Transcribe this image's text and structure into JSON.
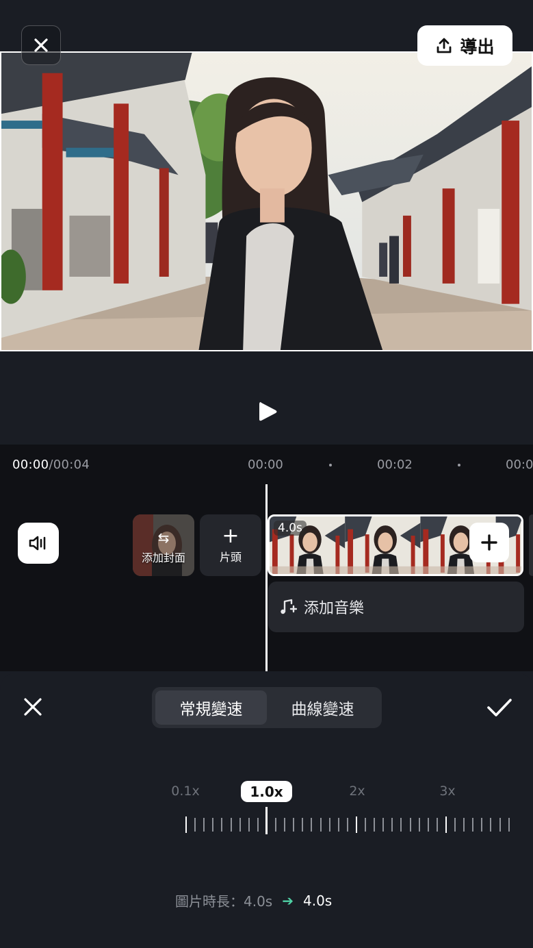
{
  "topbar": {
    "export_label": "導出"
  },
  "timeline": {
    "current_time": "00:00",
    "total_time": "/00:04",
    "ruler": [
      "00:00",
      "00:02",
      "00:0"
    ],
    "cover_label": "添加封面",
    "head_label": "片頭",
    "clip_duration": "4.0s",
    "music_label": "添加音樂"
  },
  "speed_panel": {
    "tabs": [
      {
        "label": "常規變速",
        "active": true
      },
      {
        "label": "曲線變速",
        "active": false
      }
    ],
    "speed_marks": [
      "0.1x",
      "2x",
      "3x"
    ],
    "selected_speed": "1.0x",
    "duration_label": "圖片時長：4.0s",
    "duration_new": "4.0s"
  },
  "colors": {
    "background": "#1a1d24",
    "timeline_bg": "#101115",
    "accent_arrow": "#4fd1a5"
  },
  "icons": [
    "close-icon",
    "export-upload-icon",
    "play-icon",
    "volume-icon",
    "swap-icon",
    "plus-icon",
    "music-note-icon",
    "check-icon",
    "arrow-right-icon"
  ]
}
